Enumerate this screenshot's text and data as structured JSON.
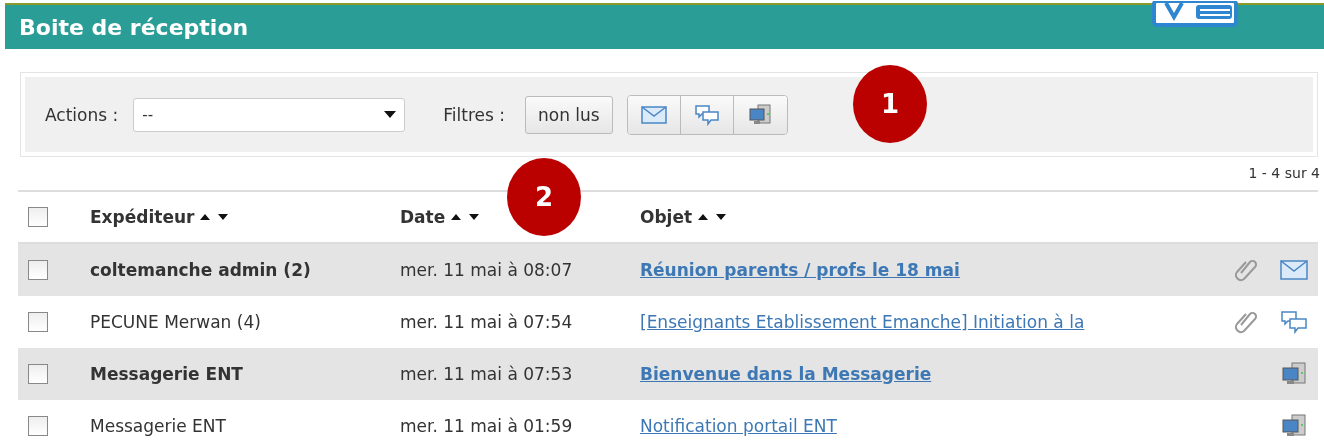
{
  "header": {
    "title": "Boite de réception"
  },
  "toolbar": {
    "actions_label": "Actions :",
    "actions_value": "--",
    "filters_label": "Filtres :",
    "unread_filter": "non lus",
    "type_filters": [
      {
        "kind": "mail"
      },
      {
        "kind": "chat"
      },
      {
        "kind": "system"
      }
    ]
  },
  "callouts": [
    "1",
    "2"
  ],
  "pager": "1 - 4 sur 4",
  "table": {
    "select_all_checked": false,
    "columns": [
      "Expéditeur",
      "Date",
      "Objet"
    ],
    "rows": [
      {
        "checked": false,
        "unread": true,
        "sender": "coltemanche admin (2)",
        "date": "mer. 11 mai à 08:07",
        "subject": "Réunion parents / profs le 18 mai",
        "attachment": true,
        "kind": "mail"
      },
      {
        "checked": false,
        "unread": false,
        "sender": "PECUNE Merwan (4)",
        "date": "mer. 11 mai à 07:54",
        "subject": "[Enseignants Etablissement Emanche] Initiation à la",
        "attachment": true,
        "kind": "chat"
      },
      {
        "checked": false,
        "unread": true,
        "sender": "Messagerie ENT",
        "date": "mer. 11 mai à 07:53",
        "subject": "Bienvenue dans la Messagerie",
        "attachment": false,
        "kind": "system"
      },
      {
        "checked": false,
        "unread": false,
        "sender": "Messagerie ENT",
        "date": "mer. 11 mai à 01:59",
        "subject": "Notification portail ENT",
        "attachment": false,
        "kind": "system"
      }
    ]
  }
}
